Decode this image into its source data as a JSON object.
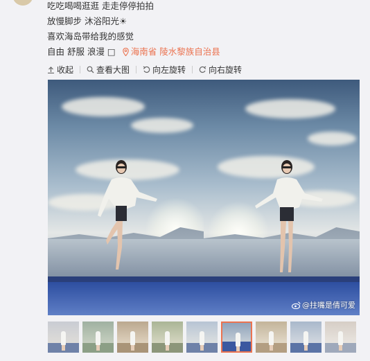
{
  "post": {
    "lines": [
      "吃吃喝喝逛逛 走走停停拍拍",
      "放慢脚步 沐浴阳光☀",
      "喜欢海岛带给我的感觉",
      "自由 舒服 浪漫 □"
    ],
    "location": "海南省 陵水黎族自治县"
  },
  "toolbar": {
    "collapse": "收起",
    "view_large": "查看大图",
    "rotate_left": "向左旋转",
    "rotate_right": "向右旋转"
  },
  "photo": {
    "watermark": "@拄嘴是倩可爱"
  },
  "thumbnails": {
    "count": 9,
    "active_index": 5
  },
  "colors": {
    "accent": "#eb7350",
    "background": "#f2f2f5",
    "text": "#333333"
  }
}
